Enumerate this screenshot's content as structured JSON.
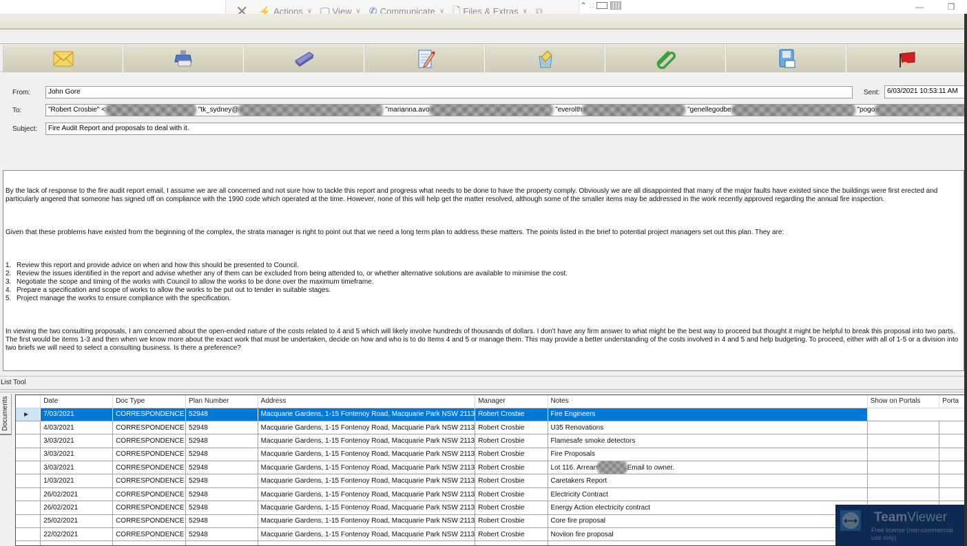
{
  "remote_toolbar": {
    "close_icon": "close-x-icon",
    "items": [
      {
        "label": "Actions",
        "icon": "lightning-icon"
      },
      {
        "label": "View",
        "icon": "monitor-brush-icon"
      },
      {
        "label": "Communicate",
        "icon": "phone-chat-icon"
      },
      {
        "label": "Files & Extras",
        "icon": "file-puzzle-icon"
      }
    ],
    "extra_icons": [
      "switch-monitor-icon",
      "collapse-caret-icon",
      "fullscreen-icon",
      "keyboard-icon",
      "grid-icon"
    ]
  },
  "window_controls": {
    "minimize": "—",
    "restore": "❐"
  },
  "toolbar": {
    "buttons": [
      {
        "name": "email",
        "icon": "envelope-icon"
      },
      {
        "name": "print",
        "icon": "printer-icon"
      },
      {
        "name": "scan",
        "icon": "scanner-icon"
      },
      {
        "name": "edit",
        "icon": "document-pencil-icon"
      },
      {
        "name": "archive",
        "icon": "wastebasket-envelope-icon"
      },
      {
        "name": "attach",
        "icon": "paperclip-icon"
      },
      {
        "name": "save",
        "icon": "floppy-disk-icon"
      },
      {
        "name": "flag",
        "icon": "red-flag-icon"
      }
    ]
  },
  "email": {
    "from_label": "From:",
    "from_value": "John Gore",
    "sent_label": "Sent:",
    "sent_value": "6/03/2021 10:53:11 AM",
    "to_label": "To:",
    "to_recipients": [
      "\"Robert Crosbie\" <",
      "\"tk_sydney@",
      "\"marianna.avo",
      "\"everolth",
      "\"genellegodbe",
      "\"pogo"
    ],
    "subject_label": "Subject:",
    "subject_value": "Fire Audit Report and proposals to deal with it.",
    "body": {
      "p1": "By the lack of response to the fire audit report email, I assume we are all concerned and not sure how to tackle this report and progress what needs to be done to have the property comply. Obviously we are all disappointed that many of the major faults have existed since the buildings were first erected and particularly angered that someone has signed off on compliance with the 1990 code which operated at the time. However, none of this will help get the matter resolved, although some of the smaller items may be addressed in the work recently approved regarding the annual fire inspection.",
      "p2": "Given that these problems have existed from the beginning of the complex, the strata manager is right to point out that we need a long term plan to address these matters. The points listed in the brief to potential project managers set out this plan. They are:",
      "list": [
        {
          "num": "1.",
          "text": "Review this report and provide advice on when and how this should be presented to Council."
        },
        {
          "num": "2.",
          "text": "Review the issues identified in the report and advise whether any of them can be excluded from being attended to, or whether alternative solutions are available to minimise the cost."
        },
        {
          "num": "3.",
          "text": "Negotiate the scope and timing of the works with Council to allow the works to be done over the maximum timeframe."
        },
        {
          "num": "4.",
          "text": "Prepare a specification and scope of works to allow the works to be put out to tender in suitable stages."
        },
        {
          "num": "5.",
          "text": "Project manage the works to ensure compliance with the specification."
        }
      ],
      "p3": "In viewing the two consulting proposals, I am concerned about the open-ended nature of the costs related to 4 and 5 which will likely involve hundreds of thousands of dollars. I don't have any firm answer to what might be the best way to proceed but thought it might be helpful to break this proposal into two parts. The first would be items 1-3 and then when we know more about the exact work that must be undertaken, decide on how and who is to do Items 4 and 5  or manage them. This may provide a better understanding of the costs involved in 4 and 5 and help budgeting. To proceed, either with all of 1-5 or a division into two briefs we will need to select a consulting business. Is there a preference?"
    }
  },
  "list_tool": {
    "title": "List Tool",
    "side_tab": "Documents",
    "columns": [
      "Date",
      "Doc Type",
      "Plan Number",
      "Address",
      "Manager",
      "Notes",
      "Show on Portals",
      "Porta"
    ],
    "selected_marker": "▶",
    "rows": [
      {
        "date": "7/03/2021",
        "doc_type": "CORRESPONDENCE",
        "plan": "52948",
        "address": "Macquarie Gardens, 1-15 Fontenoy Road, Macquarie Park  NSW  2113",
        "manager": "Robert Crosbie",
        "notes": "Fire Engineers",
        "selected": true
      },
      {
        "date": "4/03/2021",
        "doc_type": "CORRESPONDENCE",
        "plan": "52948",
        "address": "Macquarie Gardens, 1-15 Fontenoy Road, Macquarie Park  NSW  2113",
        "manager": "Robert Crosbie",
        "notes": "U35 Renovations"
      },
      {
        "date": "3/03/2021",
        "doc_type": "CORRESPONDENCE",
        "plan": "52948",
        "address": "Macquarie Gardens, 1-15 Fontenoy Road, Macquarie Park  NSW  2113",
        "manager": "Robert Crosbie",
        "notes": "Flamesafe smoke detectors"
      },
      {
        "date": "3/03/2021",
        "doc_type": "CORRESPONDENCE",
        "plan": "52948",
        "address": "Macquarie Gardens, 1-15 Fontenoy Road, Macquarie Park  NSW  2113",
        "manager": "Robert Crosbie",
        "notes": "Fire Proposals"
      },
      {
        "date": "3/03/2021",
        "doc_type": "CORRESPONDENCE",
        "plan": "52948",
        "address": "Macquarie Gardens, 1-15 Fontenoy Road, Macquarie Park  NSW  2113",
        "manager": "Robert Crosbie",
        "notes": "Lot 116. Arrears",
        "notes_suffix": "Email to owner.",
        "redacted": true
      },
      {
        "date": "1/03/2021",
        "doc_type": "CORRESPONDENCE",
        "plan": "52948",
        "address": "Macquarie Gardens, 1-15 Fontenoy Road, Macquarie Park  NSW  2113",
        "manager": "Robert Crosbie",
        "notes": "Caretakers Report"
      },
      {
        "date": "26/02/2021",
        "doc_type": "CORRESPONDENCE",
        "plan": "52948",
        "address": "Macquarie Gardens, 1-15 Fontenoy Road, Macquarie Park  NSW  2113",
        "manager": "Robert Crosbie",
        "notes": "Electricity Contract"
      },
      {
        "date": "26/02/2021",
        "doc_type": "CORRESPONDENCE",
        "plan": "52948",
        "address": "Macquarie Gardens, 1-15 Fontenoy Road, Macquarie Park  NSW  2113",
        "manager": "Robert Crosbie",
        "notes": "Energy Action electricity contract"
      },
      {
        "date": "25/02/2021",
        "doc_type": "CORRESPONDENCE",
        "plan": "52948",
        "address": "Macquarie Gardens, 1-15 Fontenoy Road, Macquarie Park  NSW  2113",
        "manager": "Robert Crosbie",
        "notes": "Core fire proposal"
      },
      {
        "date": "22/02/2021",
        "doc_type": "CORRESPONDENCE",
        "plan": "52948",
        "address": "Macquarie Gardens, 1-15 Fontenoy Road, Macquarie Park  NSW  2113",
        "manager": "Robert Crosbie",
        "notes": "Noviion fire proposal"
      }
    ]
  },
  "teamviewer": {
    "brand_bold": "Team",
    "brand_light": "Viewer",
    "license": "Free license (non-commercial use only)"
  }
}
